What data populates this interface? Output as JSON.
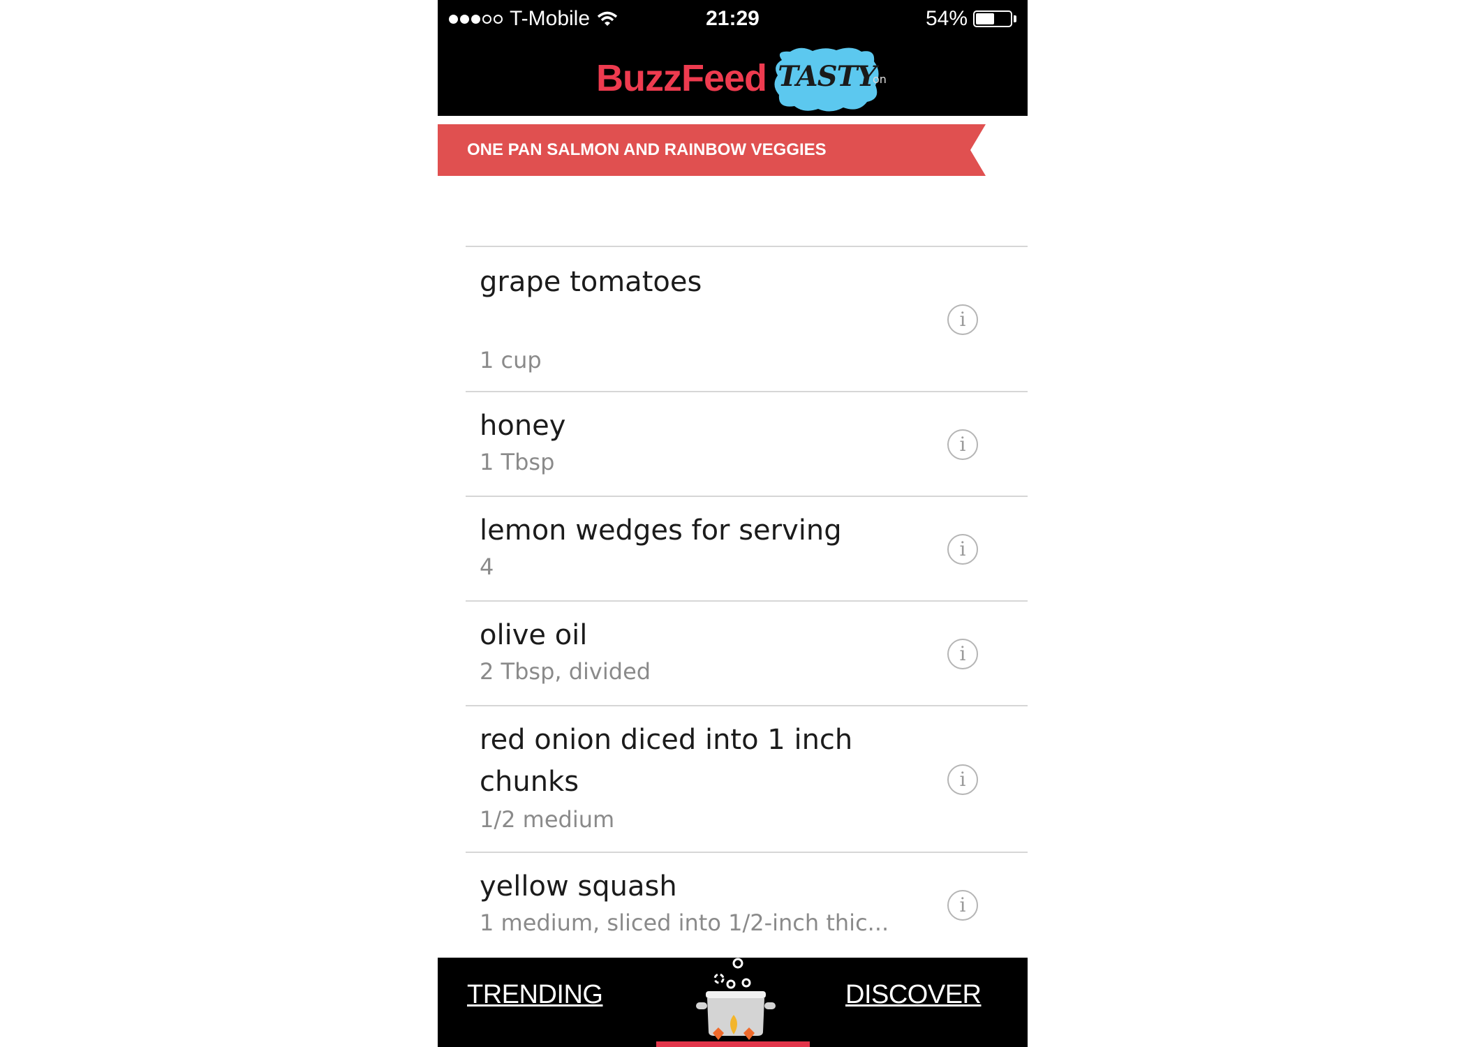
{
  "status_bar": {
    "carrier": "T-Mobile",
    "signal_bars_filled": 3,
    "signal_bars_total": 5,
    "time": "21:29",
    "battery_percent": "54%",
    "battery_level": 0.54
  },
  "header": {
    "brand": "BuzzFeed",
    "sub_brand": "TASTY",
    "suffix": "on",
    "brand_color": "#ee3b4f",
    "tasty_color": "#5cc8ef"
  },
  "recipe": {
    "title": "ONE PAN SALMON AND RAINBOW VEGGIES",
    "banner_color": "#e05050"
  },
  "ingredients": [
    {
      "name": "grape tomatoes",
      "quantity": "1 cup"
    },
    {
      "name": "honey",
      "quantity": "1 Tbsp"
    },
    {
      "name": "lemon wedges for serving",
      "quantity": "4"
    },
    {
      "name": "olive oil",
      "quantity": "2 Tbsp, divided"
    },
    {
      "name": "red onion diced into 1 inch",
      "name_line2": "chunks",
      "quantity": "1/2 medium"
    },
    {
      "name": "yellow squash",
      "quantity": "1 medium, sliced into 1/2-inch thic..."
    }
  ],
  "info_icon_glyph": "i",
  "bottom_nav": {
    "left": "TRENDING",
    "right": "DISCOVER",
    "center_icon": "cooking-pot-icon"
  }
}
